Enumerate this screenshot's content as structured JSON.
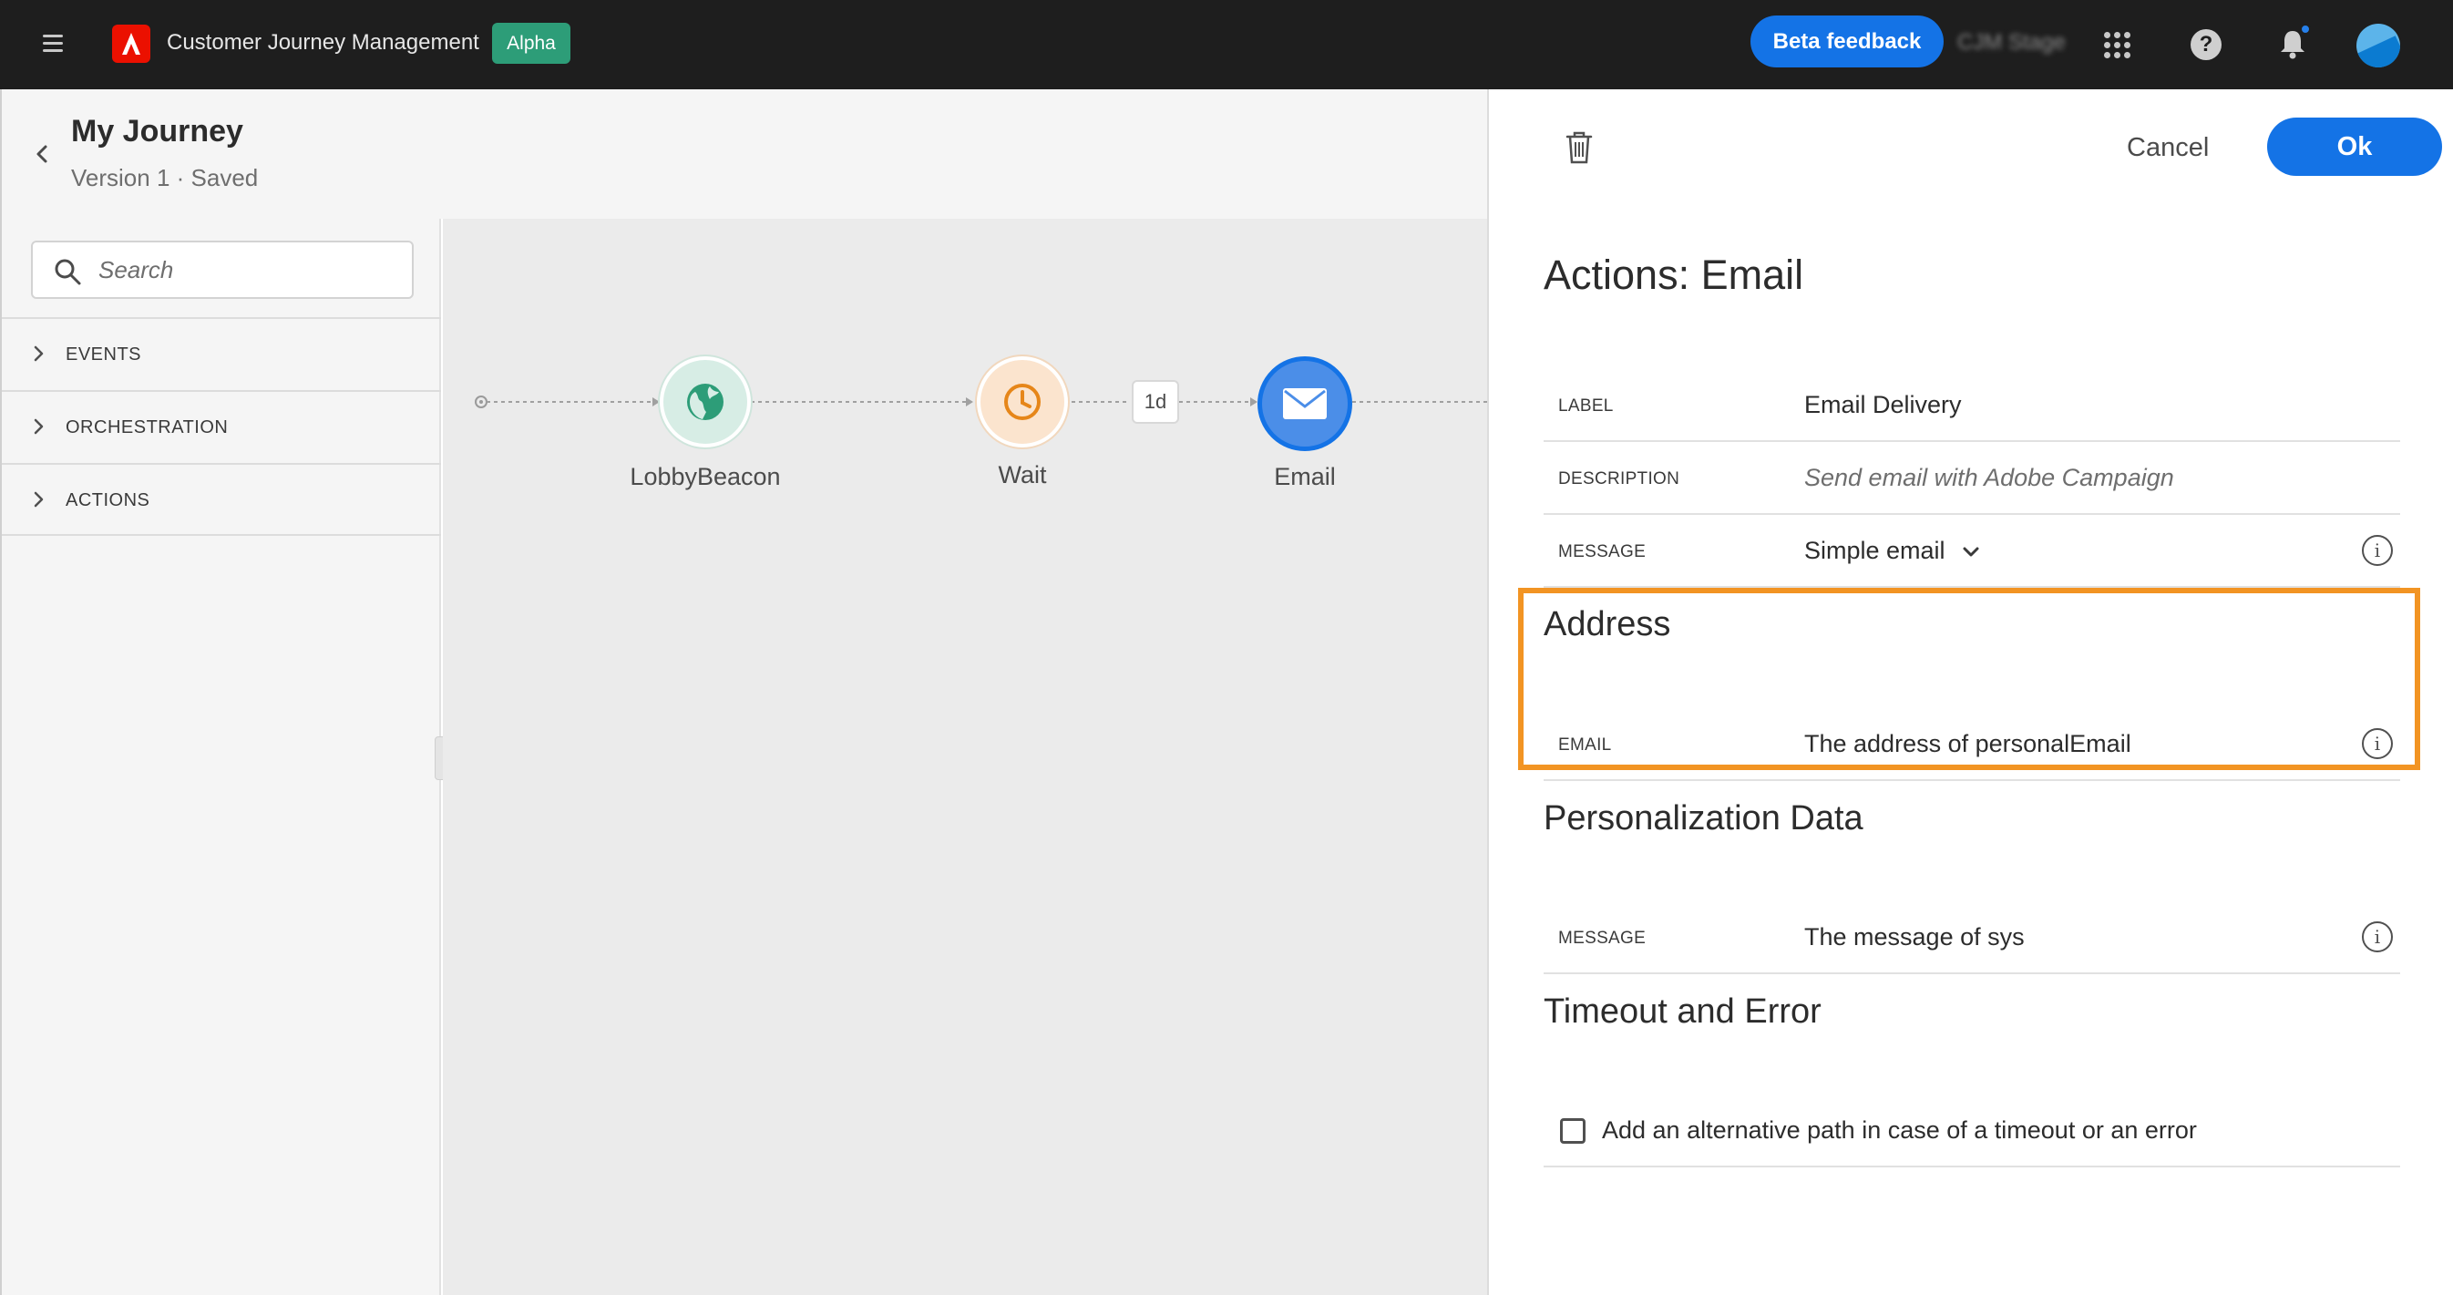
{
  "topbar": {
    "app_title": "Customer Journey Management",
    "badge": "Alpha",
    "beta_feedback": "Beta feedback",
    "org_name": "CJM Stage"
  },
  "journey": {
    "title": "My Journey",
    "version": "Version 1 · Saved"
  },
  "sidebar": {
    "search_placeholder": "Search",
    "categories": [
      {
        "label": "EVENTS"
      },
      {
        "label": "ORCHESTRATION"
      },
      {
        "label": "ACTIONS"
      }
    ]
  },
  "canvas": {
    "nodes": [
      {
        "label": "LobbyBeacon",
        "icon": "globe-icon",
        "color": "#2d9d78"
      },
      {
        "label": "Wait",
        "icon": "clock-icon",
        "color": "#e68619"
      },
      {
        "label": "Email",
        "icon": "envelope-icon",
        "color": "#1473e6"
      }
    ],
    "wait_duration": "1d"
  },
  "panel": {
    "cancel": "Cancel",
    "ok": "Ok",
    "title": "Actions: Email",
    "label_key": "LABEL",
    "label_value": "Email Delivery",
    "description_key": "DESCRIPTION",
    "description_placeholder": "Send email with Adobe Campaign",
    "message_key": "MESSAGE",
    "message_value": "Simple email",
    "address_title": "Address",
    "email_key": "EMAIL",
    "email_value": "The address of personalEmail",
    "personalization_title": "Personalization Data",
    "pers_message_key": "MESSAGE",
    "pers_message_value": "The message of sys",
    "timeout_title": "Timeout and Error",
    "timeout_checkbox_label": "Add an alternative path in case of a timeout or an error",
    "timeout_checked": false
  },
  "colors": {
    "topbar": "#1e1e1e",
    "accent": "#1473e6",
    "badge": "#2d9d78",
    "highlight": "#f29423"
  }
}
